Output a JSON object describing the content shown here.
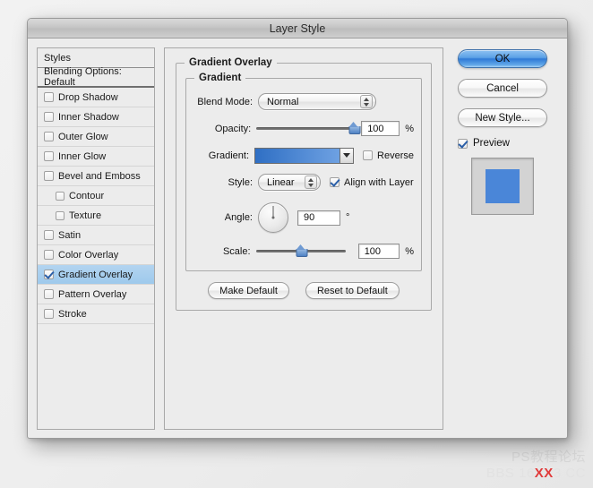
{
  "window": {
    "title": "Layer Style"
  },
  "styles_panel": {
    "header": "Styles",
    "blending_options": "Blending Options: Default",
    "items": [
      {
        "label": "Drop Shadow",
        "checked": false,
        "sub": false,
        "selected": false
      },
      {
        "label": "Inner Shadow",
        "checked": false,
        "sub": false,
        "selected": false
      },
      {
        "label": "Outer Glow",
        "checked": false,
        "sub": false,
        "selected": false
      },
      {
        "label": "Inner Glow",
        "checked": false,
        "sub": false,
        "selected": false
      },
      {
        "label": "Bevel and Emboss",
        "checked": false,
        "sub": false,
        "selected": false
      },
      {
        "label": "Contour",
        "checked": false,
        "sub": true,
        "selected": false
      },
      {
        "label": "Texture",
        "checked": false,
        "sub": true,
        "selected": false
      },
      {
        "label": "Satin",
        "checked": false,
        "sub": false,
        "selected": false
      },
      {
        "label": "Color Overlay",
        "checked": false,
        "sub": false,
        "selected": false
      },
      {
        "label": "Gradient Overlay",
        "checked": true,
        "sub": false,
        "selected": true
      },
      {
        "label": "Pattern Overlay",
        "checked": false,
        "sub": false,
        "selected": false
      },
      {
        "label": "Stroke",
        "checked": false,
        "sub": false,
        "selected": false
      }
    ]
  },
  "options": {
    "section_title": "Gradient Overlay",
    "group_title": "Gradient",
    "blend_mode": {
      "label": "Blend Mode:",
      "value": "Normal"
    },
    "opacity": {
      "label": "Opacity:",
      "value": "100",
      "unit": "%",
      "percent": 100
    },
    "gradient": {
      "label": "Gradient:",
      "start_color": "#2f6fc4",
      "end_color": "#6ea1e2",
      "reverse_label": "Reverse",
      "reverse_checked": false
    },
    "style": {
      "label": "Style:",
      "value": "Linear",
      "align_label": "Align with Layer",
      "align_checked": true
    },
    "angle": {
      "label": "Angle:",
      "value": "90",
      "unit": "°"
    },
    "scale": {
      "label": "Scale:",
      "value": "100",
      "unit": "%",
      "percent": 50
    },
    "make_default": "Make Default",
    "reset_to_default": "Reset to Default"
  },
  "buttons": {
    "ok": "OK",
    "cancel": "Cancel",
    "new_style": "New Style...",
    "preview_label": "Preview",
    "preview_checked": true,
    "preview_square_color": "#4a86d8"
  },
  "watermark": {
    "line1": "PS教程论坛",
    "line2_prefix": "BBS 16",
    "line2_red": "XX",
    "line2_suffix": "3 CC"
  }
}
